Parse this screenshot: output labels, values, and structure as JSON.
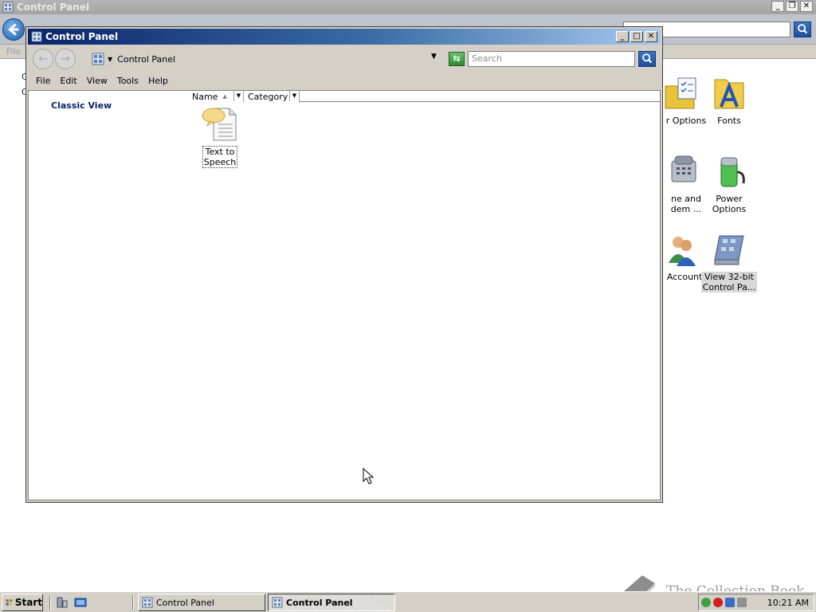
{
  "background_window": {
    "title": "Control Panel",
    "menu_file": "File",
    "icons": [
      {
        "label": "r Options",
        "icon": "folder-options-icon"
      },
      {
        "label": "Fonts",
        "icon": "fonts-folder-icon"
      },
      {
        "label": "ne and\ndem ...",
        "icon": "phone-modem-icon"
      },
      {
        "label": "Power Options",
        "icon": "power-options-icon"
      },
      {
        "label": "Accounts",
        "icon": "user-accounts-icon"
      },
      {
        "label": "View 32-bit\nControl Pa...",
        "icon": "control-panel-32bit-icon"
      }
    ],
    "left_fragments": [
      "C",
      "C"
    ]
  },
  "window": {
    "title": "Control Panel",
    "address": {
      "path": "Control Panel"
    },
    "search": {
      "placeholder": "Search"
    },
    "menu": [
      "File",
      "Edit",
      "View",
      "Tools",
      "Help"
    ],
    "taskpane": {
      "classic_view": "Classic View"
    },
    "columns": [
      {
        "label": "Name",
        "sorted": true
      },
      {
        "label": "Category",
        "sorted": false
      }
    ],
    "items": [
      {
        "label": "Text to\nSpeech",
        "icon": "text-to-speech-icon"
      }
    ]
  },
  "taskbar": {
    "start_label": "Start",
    "tasks": [
      {
        "label": "Control Panel",
        "active": false
      },
      {
        "label": "Control Panel",
        "active": true
      }
    ],
    "clock": "10:21 AM"
  },
  "watermark": "The Collection Book",
  "colors": {
    "title_active_start": "#0a246a",
    "title_active_end": "#a6caf0",
    "link_blue": "#0a246a",
    "chrome": "#d4d0c8"
  }
}
